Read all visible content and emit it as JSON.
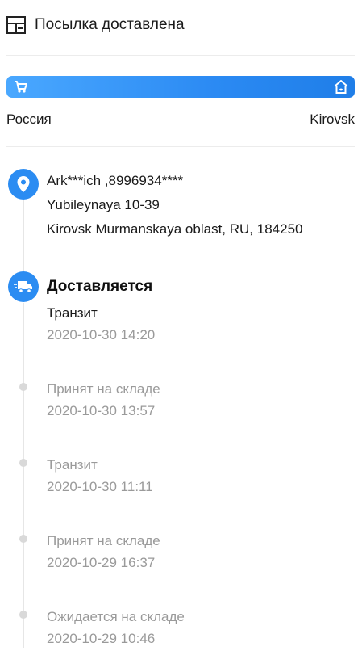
{
  "header": {
    "title": "Посылка доставлена",
    "icon": "package-icon"
  },
  "route": {
    "origin": "Россия",
    "destination": "Kirovsk",
    "left_icon": "shopping-cart-icon",
    "right_icon": "home-icon",
    "bar_color": "#2b8af3"
  },
  "address": {
    "recipient": "Ark***ich ,8996934****",
    "street": "Yubileynaya 10-39",
    "city_line": "Kirovsk Murmanskaya oblast, RU, 184250",
    "icon": "location-pin-icon"
  },
  "current_status": {
    "title": "Доставляется",
    "icon": "delivery-truck-icon"
  },
  "events": [
    {
      "description": "Транзит",
      "time": "2020-10-30 14:20"
    },
    {
      "description": "Принят на складе",
      "time": "2020-10-30 13:57"
    },
    {
      "description": "Транзит",
      "time": "2020-10-30 11:11"
    },
    {
      "description": "Принят на складе",
      "time": "2020-10-29 16:37"
    },
    {
      "description": "Ожидается на складе",
      "time": "2020-10-29 10:46"
    }
  ],
  "colors": {
    "accent": "#2b8cf2",
    "muted_text": "#9a9a9a",
    "divider": "#ececec"
  }
}
